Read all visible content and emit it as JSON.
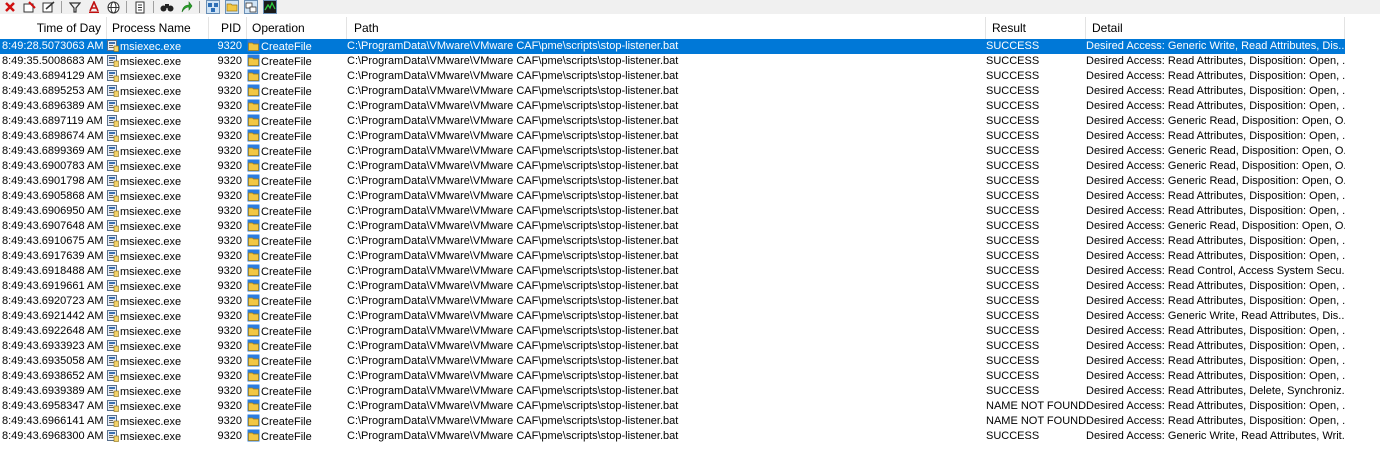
{
  "toolbar": {
    "icons": [
      "clear-icon",
      "highlight-icon",
      "autoscroll-icon",
      "filter-icon",
      "text-filter-icon",
      "network-icon",
      "process-tree-icon",
      "find-icon",
      "jump-to-icon",
      "registry-activity-icon",
      "file-activity-icon",
      "network-activity-icon",
      "profiling-icon"
    ]
  },
  "columns": {
    "time": "Time of Day",
    "process": "Process Name",
    "pid": "PID",
    "operation": "Operation",
    "path": "Path",
    "result": "Result",
    "detail": "Detail"
  },
  "colors": {
    "selection": "#0078d7",
    "header_border": "#e3e3e3",
    "toolbar_bg": "#f0f0f0"
  },
  "rows": [
    {
      "time": "8:49:28.5073063 AM",
      "process": "msiexec.exe",
      "pid": "9320",
      "operation": "CreateFile",
      "path": "C:\\ProgramData\\VMware\\VMware CAF\\pme\\scripts\\stop-listener.bat",
      "result": "SUCCESS",
      "detail": "Desired Access: Generic Write, Read Attributes, Dis...",
      "selected": true
    },
    {
      "time": "8:49:35.5008683 AM",
      "process": "msiexec.exe",
      "pid": "9320",
      "operation": "CreateFile",
      "path": "C:\\ProgramData\\VMware\\VMware CAF\\pme\\scripts\\stop-listener.bat",
      "result": "SUCCESS",
      "detail": "Desired Access: Read Attributes, Disposition: Open, ..."
    },
    {
      "time": "8:49:43.6894129 AM",
      "process": "msiexec.exe",
      "pid": "9320",
      "operation": "CreateFile",
      "path": "C:\\ProgramData\\VMware\\VMware CAF\\pme\\scripts\\stop-listener.bat",
      "result": "SUCCESS",
      "detail": "Desired Access: Read Attributes, Disposition: Open, ..."
    },
    {
      "time": "8:49:43.6895253 AM",
      "process": "msiexec.exe",
      "pid": "9320",
      "operation": "CreateFile",
      "path": "C:\\ProgramData\\VMware\\VMware CAF\\pme\\scripts\\stop-listener.bat",
      "result": "SUCCESS",
      "detail": "Desired Access: Read Attributes, Disposition: Open, ..."
    },
    {
      "time": "8:49:43.6896389 AM",
      "process": "msiexec.exe",
      "pid": "9320",
      "operation": "CreateFile",
      "path": "C:\\ProgramData\\VMware\\VMware CAF\\pme\\scripts\\stop-listener.bat",
      "result": "SUCCESS",
      "detail": "Desired Access: Read Attributes, Disposition: Open, ..."
    },
    {
      "time": "8:49:43.6897119 AM",
      "process": "msiexec.exe",
      "pid": "9320",
      "operation": "CreateFile",
      "path": "C:\\ProgramData\\VMware\\VMware CAF\\pme\\scripts\\stop-listener.bat",
      "result": "SUCCESS",
      "detail": "Desired Access: Generic Read, Disposition: Open, O..."
    },
    {
      "time": "8:49:43.6898674 AM",
      "process": "msiexec.exe",
      "pid": "9320",
      "operation": "CreateFile",
      "path": "C:\\ProgramData\\VMware\\VMware CAF\\pme\\scripts\\stop-listener.bat",
      "result": "SUCCESS",
      "detail": "Desired Access: Read Attributes, Disposition: Open, ..."
    },
    {
      "time": "8:49:43.6899369 AM",
      "process": "msiexec.exe",
      "pid": "9320",
      "operation": "CreateFile",
      "path": "C:\\ProgramData\\VMware\\VMware CAF\\pme\\scripts\\stop-listener.bat",
      "result": "SUCCESS",
      "detail": "Desired Access: Generic Read, Disposition: Open, O..."
    },
    {
      "time": "8:49:43.6900783 AM",
      "process": "msiexec.exe",
      "pid": "9320",
      "operation": "CreateFile",
      "path": "C:\\ProgramData\\VMware\\VMware CAF\\pme\\scripts\\stop-listener.bat",
      "result": "SUCCESS",
      "detail": "Desired Access: Generic Read, Disposition: Open, O..."
    },
    {
      "time": "8:49:43.6901798 AM",
      "process": "msiexec.exe",
      "pid": "9320",
      "operation": "CreateFile",
      "path": "C:\\ProgramData\\VMware\\VMware CAF\\pme\\scripts\\stop-listener.bat",
      "result": "SUCCESS",
      "detail": "Desired Access: Generic Read, Disposition: Open, O..."
    },
    {
      "time": "8:49:43.6905868 AM",
      "process": "msiexec.exe",
      "pid": "9320",
      "operation": "CreateFile",
      "path": "C:\\ProgramData\\VMware\\VMware CAF\\pme\\scripts\\stop-listener.bat",
      "result": "SUCCESS",
      "detail": "Desired Access: Read Attributes, Disposition: Open, ..."
    },
    {
      "time": "8:49:43.6906950 AM",
      "process": "msiexec.exe",
      "pid": "9320",
      "operation": "CreateFile",
      "path": "C:\\ProgramData\\VMware\\VMware CAF\\pme\\scripts\\stop-listener.bat",
      "result": "SUCCESS",
      "detail": "Desired Access: Read Attributes, Disposition: Open, ..."
    },
    {
      "time": "8:49:43.6907648 AM",
      "process": "msiexec.exe",
      "pid": "9320",
      "operation": "CreateFile",
      "path": "C:\\ProgramData\\VMware\\VMware CAF\\pme\\scripts\\stop-listener.bat",
      "result": "SUCCESS",
      "detail": "Desired Access: Generic Read, Disposition: Open, O..."
    },
    {
      "time": "8:49:43.6910675 AM",
      "process": "msiexec.exe",
      "pid": "9320",
      "operation": "CreateFile",
      "path": "C:\\ProgramData\\VMware\\VMware CAF\\pme\\scripts\\stop-listener.bat",
      "result": "SUCCESS",
      "detail": "Desired Access: Read Attributes, Disposition: Open, ..."
    },
    {
      "time": "8:49:43.6917639 AM",
      "process": "msiexec.exe",
      "pid": "9320",
      "operation": "CreateFile",
      "path": "C:\\ProgramData\\VMware\\VMware CAF\\pme\\scripts\\stop-listener.bat",
      "result": "SUCCESS",
      "detail": "Desired Access: Read Attributes, Disposition: Open, ..."
    },
    {
      "time": "8:49:43.6918488 AM",
      "process": "msiexec.exe",
      "pid": "9320",
      "operation": "CreateFile",
      "path": "C:\\ProgramData\\VMware\\VMware CAF\\pme\\scripts\\stop-listener.bat",
      "result": "SUCCESS",
      "detail": "Desired Access: Read Control, Access System Secu..."
    },
    {
      "time": "8:49:43.6919661 AM",
      "process": "msiexec.exe",
      "pid": "9320",
      "operation": "CreateFile",
      "path": "C:\\ProgramData\\VMware\\VMware CAF\\pme\\scripts\\stop-listener.bat",
      "result": "SUCCESS",
      "detail": "Desired Access: Read Attributes, Disposition: Open, ..."
    },
    {
      "time": "8:49:43.6920723 AM",
      "process": "msiexec.exe",
      "pid": "9320",
      "operation": "CreateFile",
      "path": "C:\\ProgramData\\VMware\\VMware CAF\\pme\\scripts\\stop-listener.bat",
      "result": "SUCCESS",
      "detail": "Desired Access: Read Attributes, Disposition: Open, ..."
    },
    {
      "time": "8:49:43.6921442 AM",
      "process": "msiexec.exe",
      "pid": "9320",
      "operation": "CreateFile",
      "path": "C:\\ProgramData\\VMware\\VMware CAF\\pme\\scripts\\stop-listener.bat",
      "result": "SUCCESS",
      "detail": "Desired Access: Generic Write, Read Attributes, Dis..."
    },
    {
      "time": "8:49:43.6922648 AM",
      "process": "msiexec.exe",
      "pid": "9320",
      "operation": "CreateFile",
      "path": "C:\\ProgramData\\VMware\\VMware CAF\\pme\\scripts\\stop-listener.bat",
      "result": "SUCCESS",
      "detail": "Desired Access: Read Attributes, Disposition: Open, ..."
    },
    {
      "time": "8:49:43.6933923 AM",
      "process": "msiexec.exe",
      "pid": "9320",
      "operation": "CreateFile",
      "path": "C:\\ProgramData\\VMware\\VMware CAF\\pme\\scripts\\stop-listener.bat",
      "result": "SUCCESS",
      "detail": "Desired Access: Read Attributes, Disposition: Open, ..."
    },
    {
      "time": "8:49:43.6935058 AM",
      "process": "msiexec.exe",
      "pid": "9320",
      "operation": "CreateFile",
      "path": "C:\\ProgramData\\VMware\\VMware CAF\\pme\\scripts\\stop-listener.bat",
      "result": "SUCCESS",
      "detail": "Desired Access: Read Attributes, Disposition: Open, ..."
    },
    {
      "time": "8:49:43.6938652 AM",
      "process": "msiexec.exe",
      "pid": "9320",
      "operation": "CreateFile",
      "path": "C:\\ProgramData\\VMware\\VMware CAF\\pme\\scripts\\stop-listener.bat",
      "result": "SUCCESS",
      "detail": "Desired Access: Read Attributes, Disposition: Open, ..."
    },
    {
      "time": "8:49:43.6939389 AM",
      "process": "msiexec.exe",
      "pid": "9320",
      "operation": "CreateFile",
      "path": "C:\\ProgramData\\VMware\\VMware CAF\\pme\\scripts\\stop-listener.bat",
      "result": "SUCCESS",
      "detail": "Desired Access: Read Attributes, Delete, Synchroniz..."
    },
    {
      "time": "8:49:43.6958347 AM",
      "process": "msiexec.exe",
      "pid": "9320",
      "operation": "CreateFile",
      "path": "C:\\ProgramData\\VMware\\VMware CAF\\pme\\scripts\\stop-listener.bat",
      "result": "NAME NOT FOUND",
      "detail": "Desired Access: Read Attributes, Disposition: Open, ..."
    },
    {
      "time": "8:49:43.6966141 AM",
      "process": "msiexec.exe",
      "pid": "9320",
      "operation": "CreateFile",
      "path": "C:\\ProgramData\\VMware\\VMware CAF\\pme\\scripts\\stop-listener.bat",
      "result": "NAME NOT FOUND",
      "detail": "Desired Access: Read Attributes, Disposition: Open, ..."
    },
    {
      "time": "8:49:43.6968300 AM",
      "process": "msiexec.exe",
      "pid": "9320",
      "operation": "CreateFile",
      "path": "C:\\ProgramData\\VMware\\VMware CAF\\pme\\scripts\\stop-listener.bat",
      "result": "SUCCESS",
      "detail": "Desired Access: Generic Write, Read Attributes, Writ..."
    }
  ]
}
